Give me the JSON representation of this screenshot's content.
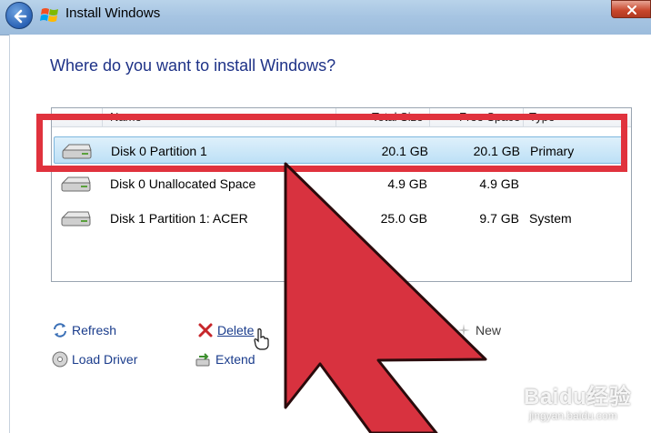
{
  "window": {
    "title": "Install Windows"
  },
  "heading": "Where do you want to install Windows?",
  "table": {
    "columns": [
      "Name",
      "Total Size",
      "Free Space",
      "Type"
    ],
    "rows": [
      {
        "name": "Disk 0 Partition 1",
        "total": "20.1 GB",
        "free": "20.1 GB",
        "type": "Primary",
        "selected": true
      },
      {
        "name": "Disk 0 Unallocated Space",
        "total": "4.9 GB",
        "free": "4.9 GB",
        "type": "",
        "selected": false
      },
      {
        "name": "Disk 1 Partition 1: ACER",
        "total": "25.0 GB",
        "free": "9.7 GB",
        "type": "System",
        "selected": false
      }
    ]
  },
  "actions": {
    "refresh": "Refresh",
    "delete": "Delete",
    "new": "New",
    "load_driver": "Load Driver",
    "extend": "Extend"
  },
  "annotation": {
    "highlight_color": "#e0323d",
    "arrow_color": "#d8323f"
  },
  "watermark": {
    "logo": "Baidu经验",
    "url": "jingyan.baidu.com"
  }
}
